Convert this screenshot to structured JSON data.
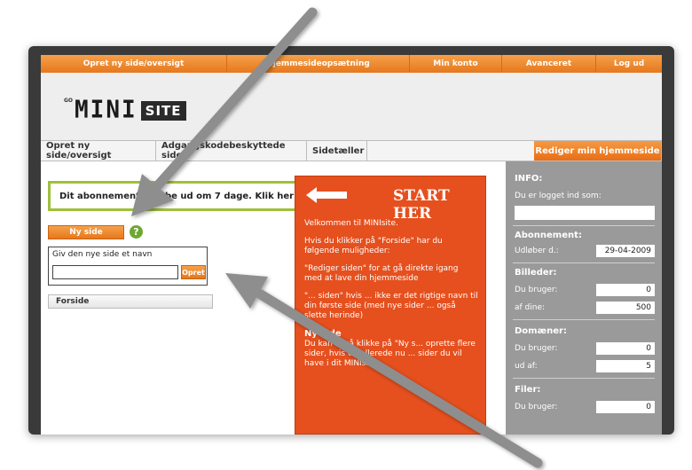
{
  "topnav": [
    "Opret ny side/oversigt",
    "Hjemmesideopsætning",
    "Min konto",
    "Avanceret",
    "Log ud"
  ],
  "logo": {
    "go": "GO",
    "mini": "MINI",
    "site": "SITE"
  },
  "tabs": [
    "Opret ny side/oversigt",
    "Adgangskodebeskyttede sider",
    "Sidetæller"
  ],
  "edit_button": "Rediger min hjemmeside",
  "notice": "Dit abonnement udløbe ud om 7 dage. Klik her fo",
  "ny_side": "Ny side",
  "help": "?",
  "name_label": "Giv den nye side et navn",
  "opret": "Opret",
  "forside": "Forside",
  "start": {
    "title": "START HER",
    "p1": "Velkommen til MINIsite.",
    "p2": "Hvis du klikker på \"Forside\" har du følgende muligheder:",
    "p3": "\"Rediger siden\" for at gå direkte igang med at lave din hjemmeside",
    "p4": "\"... siden\" hvis ... ikke er det rigtige navn til din første side (med nye sider ... også slette herinde)",
    "p5_head": "Ny side",
    "p5": "Du kan også klikke på \"Ny s... oprette flere sider, hvis du allerede nu ... sider du vil have i dit MINIsite."
  },
  "sidebar": {
    "info_head": "INFO:",
    "logged_in": "Du er logget ind som:",
    "abonnement_head": "Abonnement:",
    "udlober_label": "Udløber d.:",
    "udlober_value": "29-04-2009",
    "billeder_head": "Billeder:",
    "billeder_bruger_label": "Du bruger:",
    "billeder_bruger_value": "0",
    "billeder_af_label": "af dine:",
    "billeder_af_value": "500",
    "domaener_head": "Domæner:",
    "domaener_bruger_label": "Du bruger:",
    "domaener_bruger_value": "0",
    "domaener_af_label": "ud af:",
    "domaener_af_value": "5",
    "filer_head": "Filer:",
    "filer_bruger_label": "Du bruger:",
    "filer_bruger_value": "0"
  }
}
